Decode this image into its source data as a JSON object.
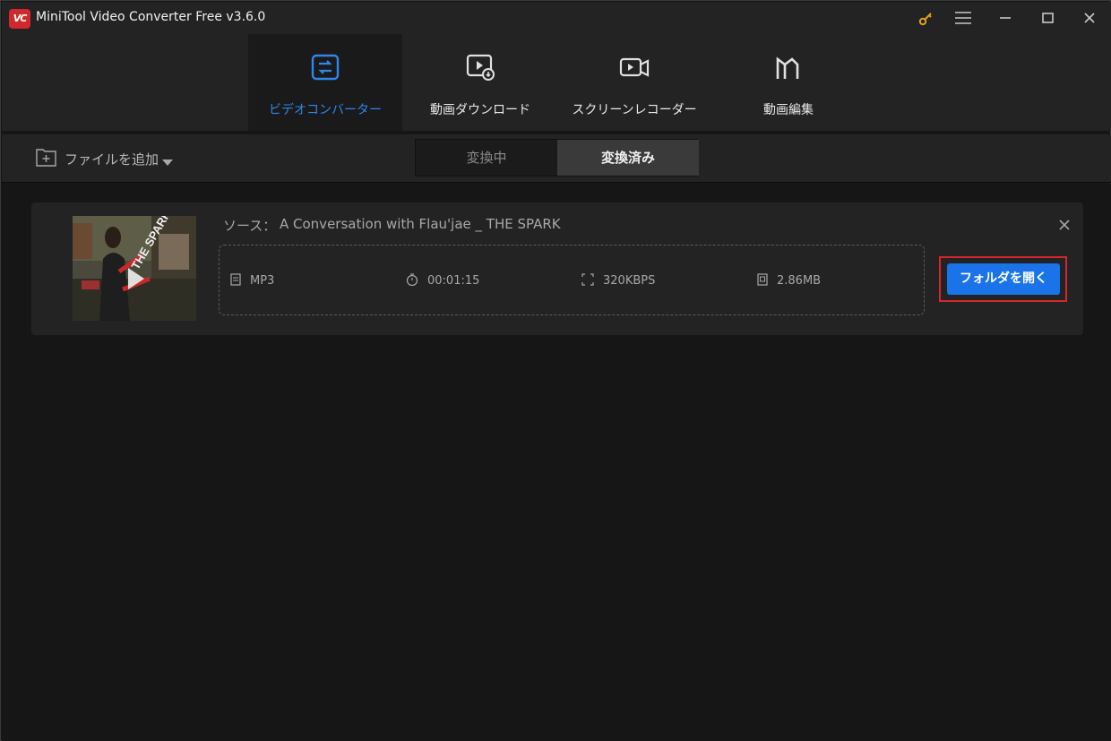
{
  "window": {
    "logo_text": "VC",
    "title": "MiniTool Video Converter Free v3.6.0",
    "accent_color": "#d0282c"
  },
  "controls": {
    "key_icon": "key-icon",
    "menu_icon": "menu-icon",
    "minimize_icon": "minimize-icon",
    "maximize_icon": "maximize-icon",
    "close_icon": "close-icon"
  },
  "nav": {
    "tabs": [
      {
        "label": "ビデオコンバーター",
        "icon": "convert-icon",
        "active": true
      },
      {
        "label": "動画ダウンロード",
        "icon": "download-video-icon",
        "active": false
      },
      {
        "label": "スクリーンレコーダー",
        "icon": "camera-icon",
        "active": false
      },
      {
        "label": "動画編集",
        "icon": "movie-edit-icon",
        "active": false
      }
    ],
    "active_color": "#2f86ee"
  },
  "toolbar": {
    "add_file_label": "ファイルを追加",
    "segments": [
      {
        "label": "変換中",
        "active": false
      },
      {
        "label": "変換済み",
        "active": true
      }
    ]
  },
  "item": {
    "source_label": "ソース：",
    "source_name": "A Conversation with Flau'jae _ THE SPARK",
    "thumbnail_overlay": "THE SPARK",
    "format": "MP3",
    "duration": "00:01:15",
    "bitrate": "320KBPS",
    "size": "2.86MB",
    "open_folder_label": "フォルダを開く",
    "button_color": "#1a73e8",
    "highlight_color": "#d6262b"
  }
}
